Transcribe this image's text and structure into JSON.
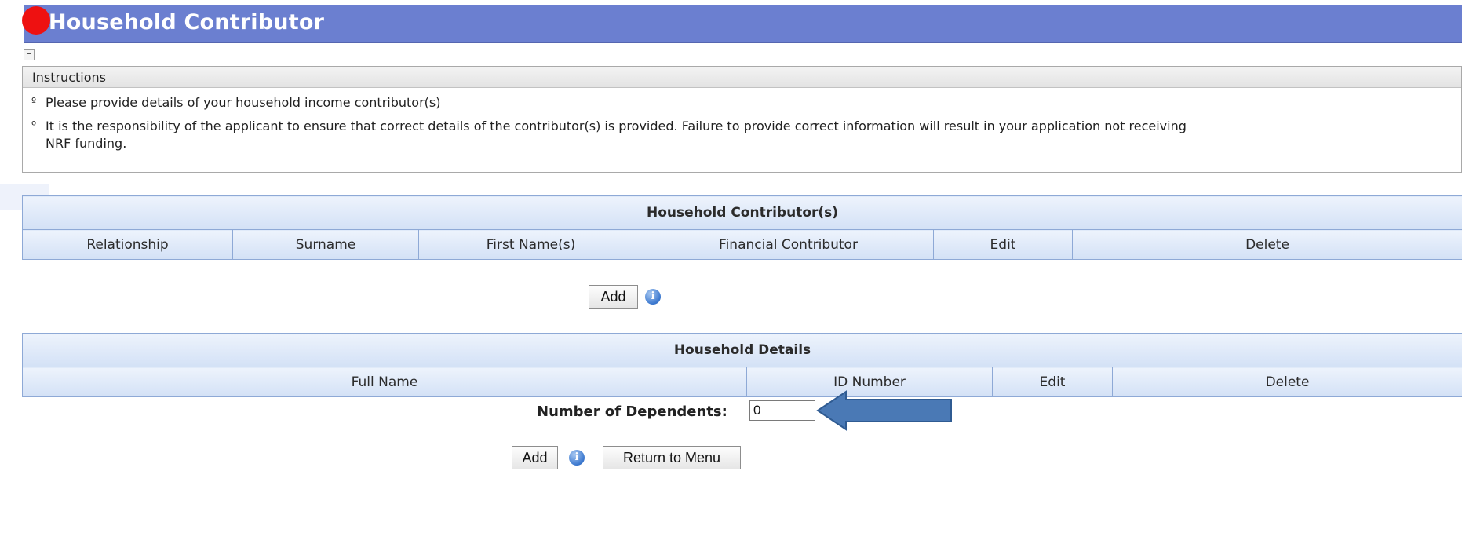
{
  "page": {
    "title": "Household Contributor"
  },
  "instructions": {
    "title": "Instructions",
    "collapse_symbol": "−",
    "bullets": [
      "Please provide details of your household income contributor(s)",
      "It is the responsibility of the applicant to ensure that correct details of the contributor(s) is provided. Failure to provide correct information will result in your application not receiving NRF funding."
    ]
  },
  "contributors_table": {
    "title": "Household Contributor(s)",
    "columns": [
      "Relationship",
      "Surname",
      "First Name(s)",
      "Financial Contributor",
      "Edit",
      "Delete"
    ],
    "add_label": "Add"
  },
  "household_table": {
    "title": "Household Details",
    "columns": [
      "Full Name",
      "ID Number",
      "Edit",
      "Delete"
    ]
  },
  "dependents": {
    "label": "Number of Dependents:",
    "value": "0"
  },
  "footer": {
    "add_label": "Add",
    "return_label": "Return to Menu"
  },
  "icons": {
    "info": "info-icon",
    "arrow": "blue-left-arrow-annotation",
    "red_marker": "red-circle-marker"
  },
  "colors": {
    "title_bar": "#6b7fd0",
    "grid_header": "#d3e1f6",
    "grid_border": "#8ea9d6",
    "arrow_fill": "#4a79b5",
    "marker": "#ee1111"
  }
}
